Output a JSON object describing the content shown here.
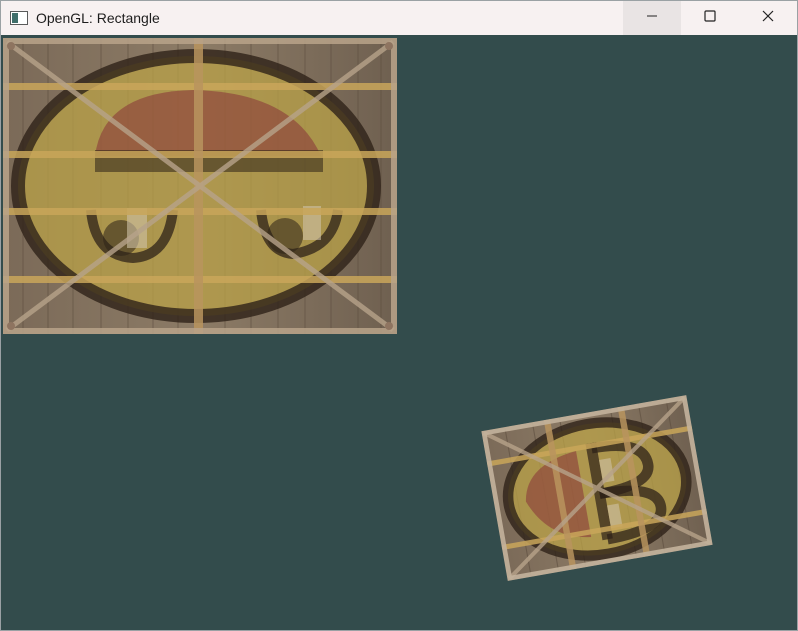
{
  "window": {
    "title": "OpenGL: Rectangle",
    "app_icon": "opengl-window-icon",
    "controls": {
      "minimize_icon": "minimize-icon",
      "maximize_icon": "maximize-icon",
      "close_icon": "close-icon"
    }
  },
  "scene": {
    "clear_color": "#334c4c",
    "objects": [
      {
        "name": "crate-with-face-large",
        "texture": "wooden-crate",
        "overlay": "smiley-face",
        "rotation_deg": 0
      },
      {
        "name": "crate-with-face-small",
        "texture": "wooden-crate",
        "overlay": "smiley-face",
        "rotation_deg": -10
      }
    ]
  },
  "colors": {
    "wood_dark": "#6b5a48",
    "wood_light": "#a89277",
    "plank_gold": "#c9a65a",
    "face_yellow": "#c7b14a",
    "face_outline": "#3a2a1c",
    "cap_red": "#8a3a3a"
  }
}
